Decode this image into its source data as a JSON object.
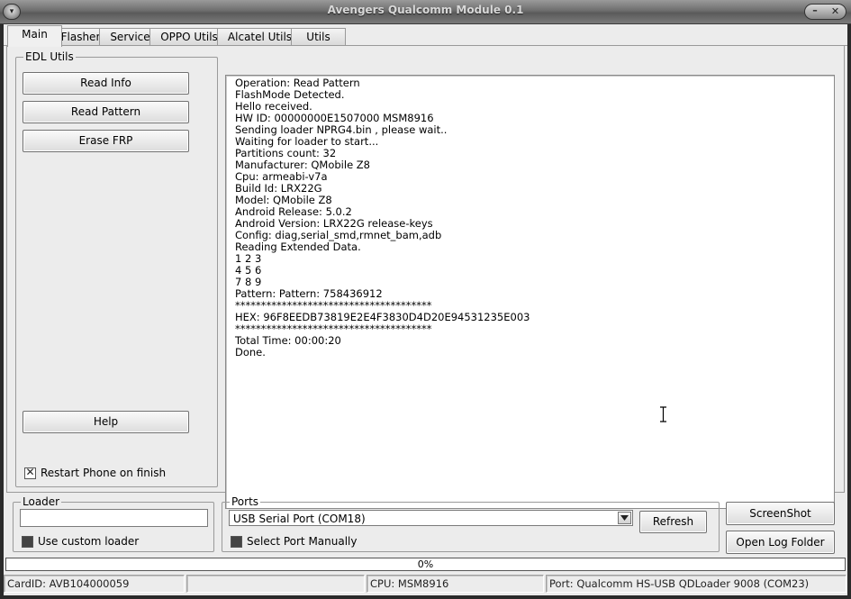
{
  "window": {
    "title": "Avengers Qualcomm Module 0.1",
    "sysmenu_glyph": "▾",
    "minimize_glyph": "–",
    "close_glyph": "✕"
  },
  "tabs": [
    {
      "label": "Main",
      "active": true
    },
    {
      "label": "Flasher",
      "active": false
    },
    {
      "label": "Service",
      "active": false
    },
    {
      "label": "OPPO Utils",
      "active": false
    },
    {
      "label": "Alcatel Utils",
      "active": false
    },
    {
      "label": "Utils",
      "active": false
    }
  ],
  "edl": {
    "group_label": "EDL Utils",
    "read_info": "Read Info",
    "read_pattern": "Read Pattern",
    "erase_frp": "Erase FRP",
    "help": "Help",
    "restart_label": "Restart Phone on finish",
    "restart_checked": true
  },
  "log": {
    "lines": [
      "Operation: Read Pattern",
      "FlashMode Detected.",
      "Hello received.",
      "HW ID: 00000000E1507000 MSM8916",
      "Sending loader NPRG4.bin , please wait..",
      "Waiting for loader to start...",
      "Partitions count: 32",
      "Manufacturer: QMobile Z8",
      "Cpu: armeabi-v7a",
      "Build Id: LRX22G",
      "Model: QMobile Z8",
      "Android Release: 5.0.2",
      "Android Version: LRX22G release-keys",
      "Config: diag,serial_smd,rmnet_bam,adb",
      "Reading Extended Data.",
      "1 2 3",
      "4 5 6",
      "7 8 9",
      "Pattern: Pattern: 758436912",
      "**************************************",
      "HEX: 96F8EEDB73819E2E4F3830D4D20E94531235E003",
      "**************************************",
      "Total Time: 00:00:20",
      "Done."
    ]
  },
  "loader": {
    "group_label": "Loader",
    "value": "",
    "custom_label": "Use custom loader",
    "custom_checked": false
  },
  "ports": {
    "group_label": "Ports",
    "selected": "USB Serial Port (COM18)",
    "refresh": "Refresh",
    "manual_label": "Select Port Manually",
    "manual_checked": false
  },
  "actions": {
    "screenshot": "ScreenShot",
    "open_log": "Open Log Folder"
  },
  "progress": {
    "value": 0,
    "label": "0%"
  },
  "status": {
    "card_id": "CardID: AVB104000059",
    "empty": "",
    "cpu": "CPU: MSM8916",
    "port": "Port: Qualcomm HS-USB QDLoader 9008 (COM23)"
  },
  "colors": {
    "progress_fill": "#4a8fd8",
    "face": "#ececec"
  }
}
